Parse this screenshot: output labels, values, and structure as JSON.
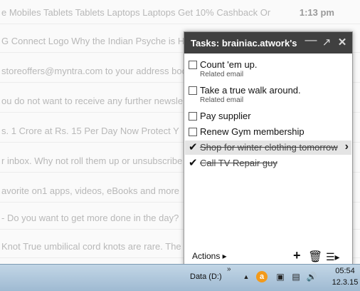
{
  "emails": [
    {
      "text": "e Mobiles Tablets Tablets Laptops Laptops Get 10% Cashback Or",
      "time": "1:13 pm"
    },
    {
      "text": "G Connect Logo Why the Indian Psyche is H",
      "time": ""
    },
    {
      "text": "storeoffers@myntra.com to your address boo",
      "time": ""
    },
    {
      "text": "ou do not want to receive any further newsle",
      "time": ""
    },
    {
      "text": "s. 1 Crore at Rs. 15 Per Day Now Protect Y",
      "time": ""
    },
    {
      "text": "r inbox. Why not roll them up or unsubscribe",
      "time": ""
    },
    {
      "text": "avorite on1 apps, videos, eBooks and more",
      "time": ""
    },
    {
      "text": "- Do you want to get more done in the day?",
      "time": ""
    },
    {
      "text": "Knot True umbilical cord knots are rare. The",
      "time": ""
    }
  ],
  "tasks_panel": {
    "title": "Tasks: brainiac.atwork's ...",
    "tasks": [
      {
        "title": "Count 'em up.",
        "subtitle": "Related email",
        "completed": false
      },
      {
        "title": "Take a true walk around.",
        "subtitle": "Related email",
        "completed": false
      },
      {
        "title": "Pay supplier",
        "subtitle": "",
        "completed": false
      },
      {
        "title": "Renew Gym membership",
        "subtitle": "",
        "completed": false
      },
      {
        "title": "Shop for winter clothing tomorrow",
        "subtitle": "",
        "completed": true,
        "selected": true
      },
      {
        "title": "Call TV Repair guy",
        "subtitle": "",
        "completed": true
      }
    ],
    "footer": {
      "actions_label": "Actions ▸"
    }
  },
  "taskbar": {
    "drive_label": "Data (D:)",
    "time": "05:54",
    "date": "12.3.15"
  },
  "colors": {
    "header_bg": "#404040",
    "taskbar_bg": "#a9c2d8",
    "selected_row": "#e4e4e4"
  }
}
